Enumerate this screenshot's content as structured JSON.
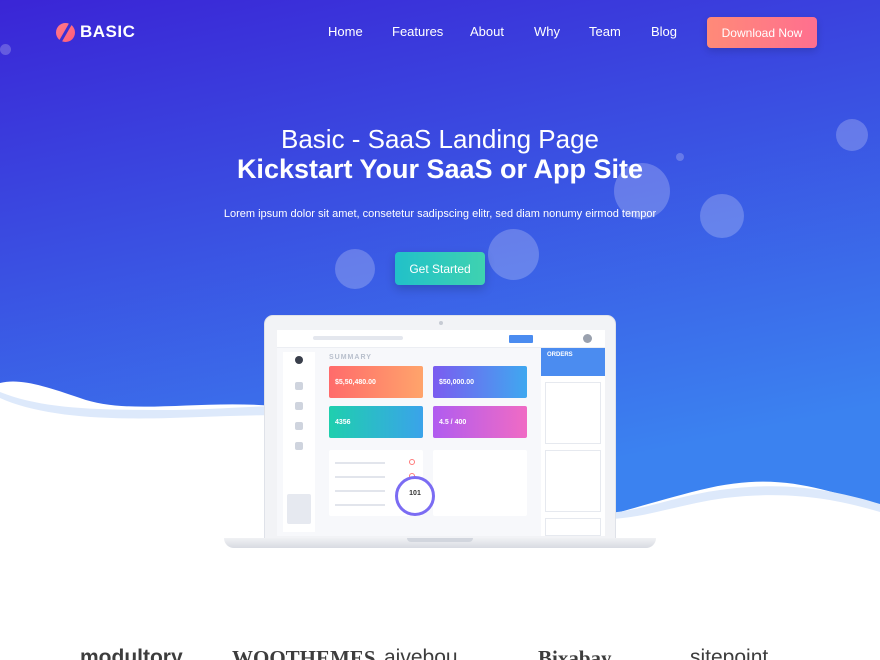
{
  "brand": {
    "name": "BASIC"
  },
  "nav": {
    "items": [
      "Home",
      "Features",
      "About",
      "Why",
      "Team",
      "Blog"
    ],
    "cta_label": "Download Now"
  },
  "hero": {
    "title": "Basic - SaaS Landing Page",
    "subtitle": "Kickstart Your SaaS or App Site",
    "description": "Lorem ipsum dolor sit amet, consetetur sadipscing elitr, sed diam nonumy eirmod tempor",
    "button_label": "Get Started"
  },
  "dashboard": {
    "summary_label": "SUMMARY",
    "orders_label": "ORDERS",
    "cards": [
      "$5,50,480.00",
      "$50,000.00",
      "4356",
      "4.5 / 400"
    ],
    "gauge_value": "101"
  },
  "partners": [
    "modultory",
    "WOOTHEMES",
    "aivebou",
    "Bixabay",
    "sitepoint"
  ],
  "colors": {
    "hero_gradient_start": "#3a25d6",
    "hero_gradient_end": "#3b7ff0",
    "cta_pink": "#ff7a82",
    "cta_teal": "#2cc6c0"
  }
}
